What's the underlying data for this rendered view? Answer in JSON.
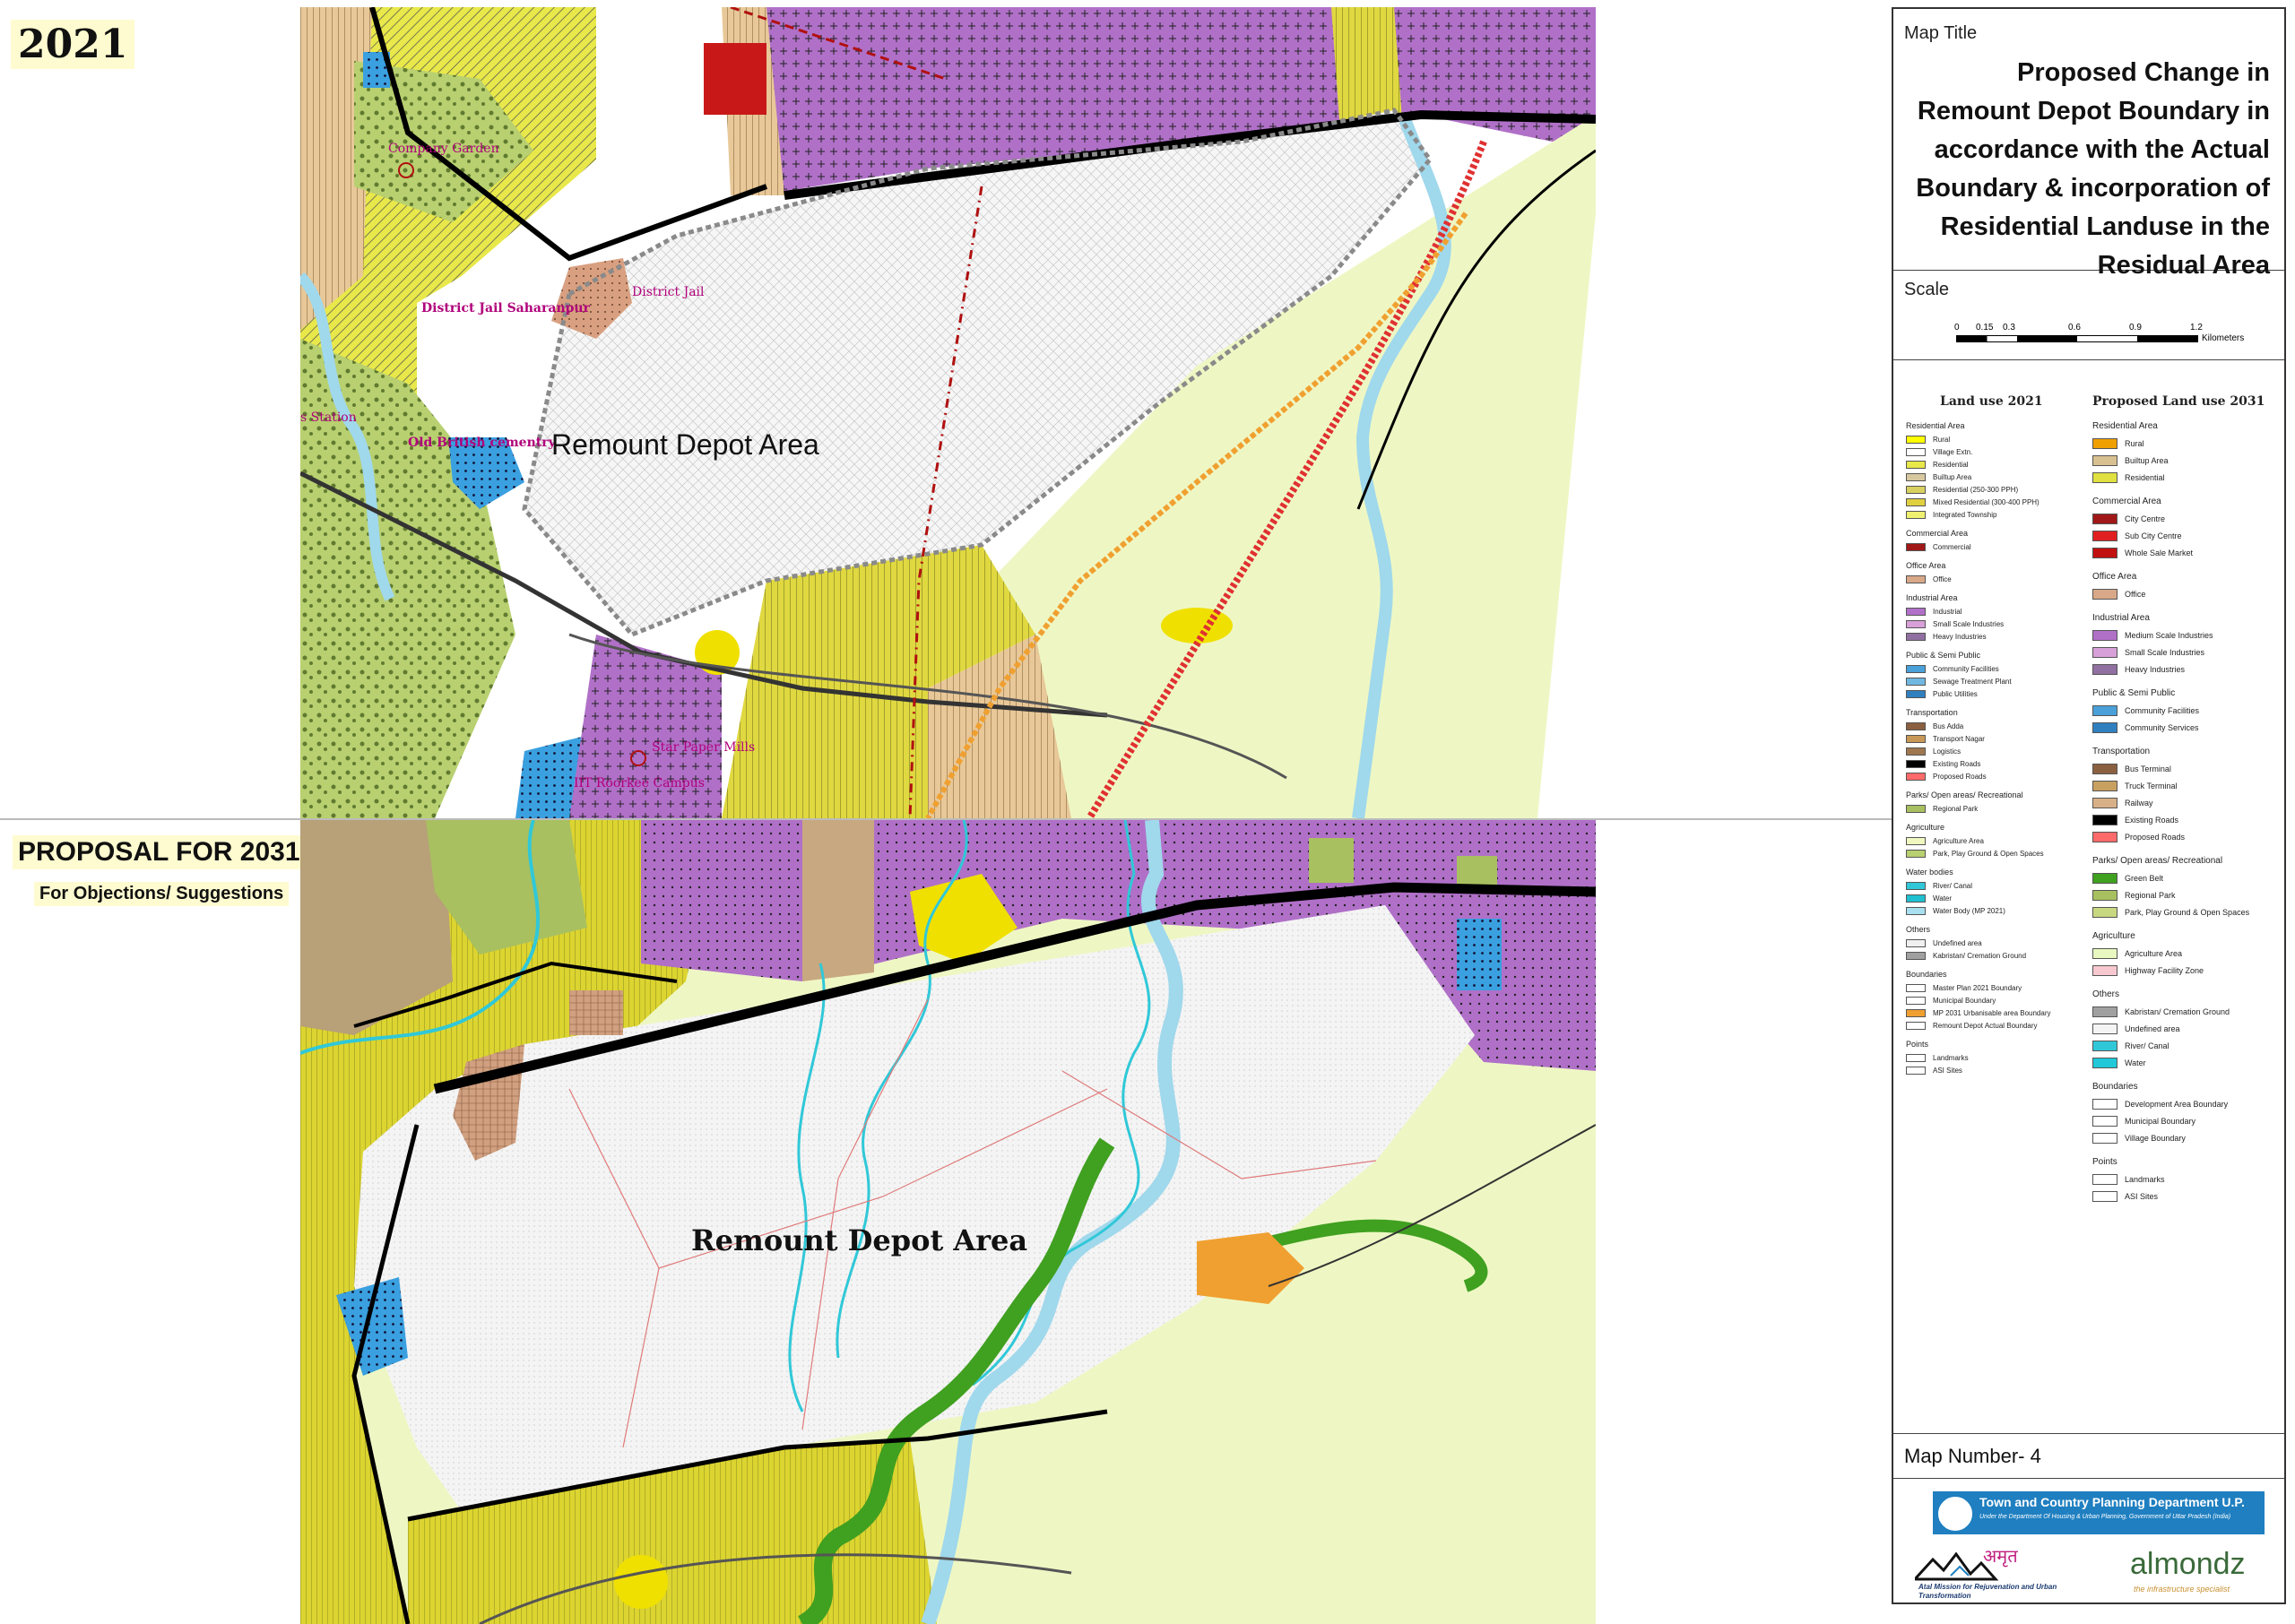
{
  "top_map": {
    "year_label": "2021",
    "labels": {
      "company_garden": "Company Garden",
      "district_jail": "District Jail",
      "district_jail_saharanpur": "District Jail Saharanpur",
      "station": "s Station",
      "old_british_cemetery": "Old British cementry",
      "remount_depot": "Remount Depot Area",
      "star_paper_mills": "Star Paper Mills",
      "iit_roorkee": "IIT Roorkee Campus"
    }
  },
  "bottom_map": {
    "title": "PROPOSAL FOR 2031",
    "subtitle": "For Objections/ Suggestions",
    "remount_depot": "Remount Depot Area"
  },
  "panel": {
    "map_title_label": "Map Title",
    "map_title": "Proposed Change in Remount Depot Boundary in accordance with the Actual Boundary & incorporation of Residential Landuse in the Residual Area",
    "scale_label": "Scale",
    "scale_ticks": [
      "0",
      "0.15",
      "0.3",
      "0.6",
      "0.9",
      "1.2"
    ],
    "scale_unit": "Kilometers",
    "map_number": "Map Number- 4",
    "org_banner": "Town and Country Planning Department U.P.",
    "org_sub": "Under the Department Of Housing & Urban Planning, Government of Uttar Pradesh (India)",
    "amrut_title": "अमृत",
    "amrut_text": "Atal Mission for Rejuvenation and Urban Transformation",
    "almondz": "almondz",
    "almondz_sub": "the infrastructure specialist"
  },
  "legend_2021": {
    "heading": "Land use 2021",
    "groups": [
      {
        "name": "Residential Area",
        "items": [
          {
            "label": "Rural",
            "color": "#ffff00"
          },
          {
            "label": "Village Extn.",
            "color": "#ffffff"
          },
          {
            "label": "Residential",
            "color": "#e8e84a"
          },
          {
            "label": "Builtup Area",
            "color": "#d8c8a0"
          },
          {
            "label": "Residential (250-300 PPH)",
            "color": "#d8d060"
          },
          {
            "label": "Mixed Residential (300-400 PPH)",
            "color": "#e0d040"
          },
          {
            "label": "Integrated Township",
            "color": "#f0f070"
          }
        ]
      },
      {
        "name": "Commercial Area",
        "items": [
          {
            "label": "Commercial",
            "color": "#a01818"
          }
        ]
      },
      {
        "name": "Office Area",
        "items": [
          {
            "label": "Office",
            "color": "#d8a888"
          }
        ]
      },
      {
        "name": "Industrial Area",
        "items": [
          {
            "label": "Industrial",
            "color": "#b070c8"
          },
          {
            "label": "Small Scale Industries",
            "color": "#d8a0d8"
          },
          {
            "label": "Heavy Industries",
            "color": "#9070a0"
          }
        ]
      },
      {
        "name": "Public & Semi Public",
        "items": [
          {
            "label": "Community Facilities",
            "color": "#4aa0d8"
          },
          {
            "label": "Sewage Treatment Plant",
            "color": "#70b8e0"
          },
          {
            "label": "Public Utilities",
            "color": "#3080c0"
          }
        ]
      },
      {
        "name": "Transportation",
        "items": [
          {
            "label": "Bus Adda",
            "color": "#8a6040"
          },
          {
            "label": "Transport Nagar",
            "color": "#c89858"
          },
          {
            "label": "Logistics",
            "color": "#a07850"
          },
          {
            "label": "Existing Roads",
            "color": "#000000"
          },
          {
            "label": "Proposed Roads",
            "color": "#ff6a6a"
          }
        ]
      },
      {
        "name": "Parks/ Open areas/ Recreational",
        "items": [
          {
            "label": "Regional Park",
            "color": "#a8c060"
          }
        ]
      },
      {
        "name": "Agriculture",
        "items": [
          {
            "label": "Agriculture Area",
            "color": "#f0f8c0"
          },
          {
            "label": "Park, Play Ground & Open Spaces",
            "color": "#b8d070"
          }
        ]
      },
      {
        "name": "Water bodies",
        "items": [
          {
            "label": "River/ Canal",
            "color": "#30c8d8"
          },
          {
            "label": "Water",
            "color": "#20c0d0"
          },
          {
            "label": "Water Body (MP 2021)",
            "color": "#a8e0f0"
          }
        ]
      },
      {
        "name": "Others",
        "items": [
          {
            "label": "Undefined area",
            "color": "#f0f0f0"
          },
          {
            "label": "Kabristan/ Cremation Ground",
            "color": "#a0a0a0"
          }
        ]
      },
      {
        "name": "Boundaries",
        "items": [
          {
            "label": "Master Plan 2021 Boundary",
            "color": "#ffffff"
          },
          {
            "label": "Municipal Boundary",
            "color": "#ffffff"
          },
          {
            "label": "MP 2031 Urbanisable area Boundary",
            "color": "#f0a030"
          },
          {
            "label": "Remount Depot Actual Boundary",
            "color": "#ffffff"
          }
        ]
      },
      {
        "name": "Points",
        "items": [
          {
            "label": "Landmarks",
            "color": "#ffffff"
          },
          {
            "label": "ASI Sites",
            "color": "#ffffff"
          }
        ]
      }
    ]
  },
  "legend_2031": {
    "heading": "Proposed Land use 2031",
    "groups": [
      {
        "name": "Residential Area",
        "items": [
          {
            "label": "Rural",
            "color": "#f0a000"
          },
          {
            "label": "Builtup Area",
            "color": "#d8c090"
          },
          {
            "label": "Residential",
            "color": "#e0e040"
          }
        ]
      },
      {
        "name": "Commercial Area",
        "items": [
          {
            "label": "City Centre",
            "color": "#a01818"
          },
          {
            "label": "Sub City Centre",
            "color": "#e02020"
          },
          {
            "label": "Whole Sale Market",
            "color": "#c01010"
          }
        ]
      },
      {
        "name": "Office Area",
        "items": [
          {
            "label": "Office",
            "color": "#d8a888"
          }
        ]
      },
      {
        "name": "Industrial Area",
        "items": [
          {
            "label": "Medium Scale Industries",
            "color": "#b070c8"
          },
          {
            "label": "Small Scale Industries",
            "color": "#d8a0d8"
          },
          {
            "label": "Heavy Industries",
            "color": "#9070a0"
          }
        ]
      },
      {
        "name": "Public & Semi Public",
        "items": [
          {
            "label": "Community Facilities",
            "color": "#4aa0d8"
          },
          {
            "label": "Community Services",
            "color": "#3080c0"
          }
        ]
      },
      {
        "name": "Transportation",
        "items": [
          {
            "label": "Bus Terminal",
            "color": "#8a6040"
          },
          {
            "label": "Truck Terminal",
            "color": "#c8a060"
          },
          {
            "label": "Railway",
            "color": "#d8b088"
          },
          {
            "label": "Existing Roads",
            "color": "#000000"
          },
          {
            "label": "Proposed Roads",
            "color": "#ff6a6a"
          }
        ]
      },
      {
        "name": "Parks/ Open areas/ Recreational",
        "items": [
          {
            "label": "Green Belt",
            "color": "#40a020"
          },
          {
            "label": "Regional Park",
            "color": "#a8c060"
          },
          {
            "label": "Park, Play Ground & Open Spaces",
            "color": "#c8d880"
          }
        ]
      },
      {
        "name": "Agriculture",
        "items": [
          {
            "label": "Agriculture Area",
            "color": "#e8f8c0"
          },
          {
            "label": "Highway Facility Zone",
            "color": "#f8c8d0"
          }
        ]
      },
      {
        "name": "Others",
        "items": [
          {
            "label": "Kabristan/ Cremation Ground",
            "color": "#a0a0a0"
          },
          {
            "label": "Undefined area",
            "color": "#f4f4f4"
          },
          {
            "label": "River/ Canal",
            "color": "#30c8d8"
          },
          {
            "label": "Water",
            "color": "#20c8d8"
          }
        ]
      },
      {
        "name": "Boundaries",
        "items": [
          {
            "label": "Development Area Boundary",
            "color": "#ffffff"
          },
          {
            "label": "Municipal Boundary",
            "color": "#ffffff"
          },
          {
            "label": "Village Boundary",
            "color": "#ffffff"
          }
        ]
      },
      {
        "name": "Points",
        "items": [
          {
            "label": "Landmarks",
            "color": "#ffffff"
          },
          {
            "label": "ASI Sites",
            "color": "#ffffff"
          }
        ]
      }
    ]
  }
}
